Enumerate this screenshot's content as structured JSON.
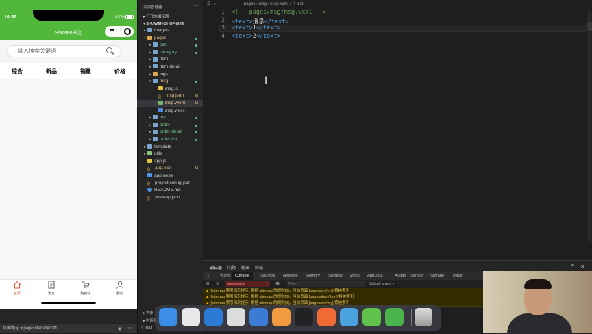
{
  "simulator": {
    "time": "10:52",
    "battery": "100%",
    "nav_title": "Shuwen书文",
    "capsule_dots": "•••",
    "search_placeholder": "输入搜索关键词",
    "categories": [
      "综合",
      "新品",
      "销量",
      "价格"
    ],
    "tabs": [
      {
        "label": "首页",
        "icon": "home-icon",
        "active": true
      },
      {
        "label": "消息",
        "icon": "message-icon"
      },
      {
        "label": "购物车",
        "icon": "cart-icon"
      },
      {
        "label": "我的",
        "icon": "user-icon"
      }
    ],
    "footer_path_label": "页面路径 ▾",
    "footer_path": "pages/item/item",
    "accent": "#52b83b"
  },
  "explorer": {
    "title": "资源管理器",
    "more": "···",
    "open_editors": "▸ 打开的编辑器",
    "project": "▾ SHUWEN-SHOP-MINI",
    "tree": [
      {
        "indent": 0,
        "arrow": "▸",
        "icon": "folder",
        "name": "images",
        "color": "",
        "mark": ""
      },
      {
        "indent": 0,
        "arrow": "▾",
        "icon": "folder-orange",
        "name": "pages",
        "color": "orange",
        "mark": "dot"
      },
      {
        "indent": 1,
        "arrow": "▸",
        "icon": "folder",
        "name": "cart",
        "color": "green",
        "mark": "dot"
      },
      {
        "indent": 1,
        "arrow": "▸",
        "icon": "folder",
        "name": "category",
        "color": "green",
        "mark": "dot"
      },
      {
        "indent": 1,
        "arrow": "▸",
        "icon": "folder",
        "name": "item",
        "color": "",
        "mark": ""
      },
      {
        "indent": 1,
        "arrow": "▸",
        "icon": "folder",
        "name": "item-detail",
        "color": "",
        "mark": ""
      },
      {
        "indent": 1,
        "arrow": "▸",
        "icon": "folder-orange",
        "name": "logs",
        "color": "",
        "mark": ""
      },
      {
        "indent": 1,
        "arrow": "▾",
        "icon": "folder",
        "name": "msg",
        "color": "orange",
        "mark": "dot"
      },
      {
        "indent": 2,
        "arrow": "",
        "icon": "js",
        "name": "msg.js",
        "color": "",
        "mark": ""
      },
      {
        "indent": 2,
        "arrow": "",
        "icon": "json",
        "name": "msg.json",
        "color": "orange",
        "mark": "M"
      },
      {
        "indent": 2,
        "arrow": "",
        "icon": "wxml",
        "name": "msg.wxml",
        "color": "orange",
        "mark": "M",
        "selected": true
      },
      {
        "indent": 2,
        "arrow": "",
        "icon": "wxss",
        "name": "msg.wxss",
        "color": "",
        "mark": ""
      },
      {
        "indent": 1,
        "arrow": "▸",
        "icon": "folder",
        "name": "my",
        "color": "green",
        "mark": "dot"
      },
      {
        "indent": 1,
        "arrow": "▸",
        "icon": "folder",
        "name": "order",
        "color": "green",
        "mark": "dot"
      },
      {
        "indent": 1,
        "arrow": "▸",
        "icon": "folder",
        "name": "order-detail",
        "color": "green",
        "mark": "dot"
      },
      {
        "indent": 1,
        "arrow": "▸",
        "icon": "folder",
        "name": "order-list",
        "color": "green",
        "mark": "dot"
      },
      {
        "indent": 0,
        "arrow": "▸",
        "icon": "folder",
        "name": "template",
        "color": "",
        "mark": ""
      },
      {
        "indent": 0,
        "arrow": "▸",
        "icon": "folder-green",
        "name": "utils",
        "color": "",
        "mark": ""
      },
      {
        "indent": 0,
        "arrow": "",
        "icon": "js",
        "name": "app.js",
        "color": "",
        "mark": ""
      },
      {
        "indent": 0,
        "arrow": "",
        "icon": "json",
        "name": "app.json",
        "color": "orange",
        "mark": "M"
      },
      {
        "indent": 0,
        "arrow": "",
        "icon": "wxss",
        "name": "app.wxss",
        "color": "",
        "mark": ""
      },
      {
        "indent": 0,
        "arrow": "",
        "icon": "json",
        "name": "project.config.json",
        "color": "",
        "mark": ""
      },
      {
        "indent": 0,
        "arrow": "",
        "icon": "md",
        "name": "README.md",
        "color": "",
        "mark": ""
      },
      {
        "indent": 0,
        "arrow": "",
        "icon": "json",
        "name": "sitemap.json",
        "color": "",
        "mark": ""
      }
    ],
    "outline": "▸ 大纲",
    "timeline": "▸ 时间线",
    "branch": "⑂ main"
  },
  "editor": {
    "toolbar": "☰  ‹  ›",
    "breadcrumb": "pages › msg › msg.wxml › ⟨⟩ text",
    "lines": [
      {
        "num": "1",
        "parts": [
          {
            "c": "cmt",
            "t": "<!-- pages/msg/msg.wxml -->"
          }
        ]
      },
      {
        "num": "2",
        "parts": [
          {
            "c": "tag",
            "t": "<text>"
          },
          {
            "c": "txt",
            "t": "消息"
          },
          {
            "c": "tag",
            "t": "</text>"
          }
        ]
      },
      {
        "num": "3",
        "parts": [
          {
            "c": "tag",
            "t": "<text>"
          },
          {
            "c": "txt",
            "t": "1"
          },
          {
            "c": "tag",
            "t": "</text>"
          }
        ]
      },
      {
        "num": "4",
        "parts": [
          {
            "c": "tag",
            "t": "<text>"
          },
          {
            "c": "txt",
            "t": "2"
          },
          {
            "c": "tag",
            "t": "</text>"
          }
        ]
      }
    ]
  },
  "debugger": {
    "tabs": [
      "调试器",
      "问题",
      "输出",
      "终端"
    ],
    "controls": [
      "⌃",
      "✕"
    ],
    "panel_tabs": [
      "Wxml",
      "Console",
      "Sources",
      "Network",
      "Memory",
      "Security",
      "Mock",
      "AppData",
      "Audits",
      "Sensor",
      "Storage",
      "Trace"
    ],
    "active_panel": "Console",
    "context": "appservice",
    "filter_placeholder": "Filter",
    "levels": "Default levels ▾",
    "warnings": [
      "[sitemap 索引情况提示] 根据 sitemap 的规则[0]，当前页面 [pages/my/my] 将被索引",
      "[sitemap 索引情况提示] 根据 sitemap 的规则[0]，当前页面 [pages/item/item] 将被索引",
      "[sitemap 索引情况提示] 根据 sitemap 的规则[0]，当前页面 [pages/my/my] 将被索引"
    ]
  },
  "dock": {
    "apps": [
      {
        "name": "finder-icon",
        "color": "#3b8ee8"
      },
      {
        "name": "chrome-icon",
        "color": "#e8e8e8"
      },
      {
        "name": "vscode-icon",
        "color": "#2b7ad6"
      },
      {
        "name": "wechat-devtools-icon",
        "color": "#dcdcdc"
      },
      {
        "name": "vector-app-icon",
        "color": "#3a7bd5"
      },
      {
        "name": "sublime-icon",
        "color": "#f29a3f"
      },
      {
        "name": "terminal-icon",
        "color": "#222222"
      },
      {
        "name": "postman-icon",
        "color": "#f06a35"
      },
      {
        "name": "paper-plane-icon",
        "color": "#4aa3df"
      },
      {
        "name": "wechat-icon",
        "color": "#5fc24a"
      },
      {
        "name": "camtasia-icon",
        "color": "#4bb34b"
      }
    ],
    "trash": "trash-icon"
  }
}
